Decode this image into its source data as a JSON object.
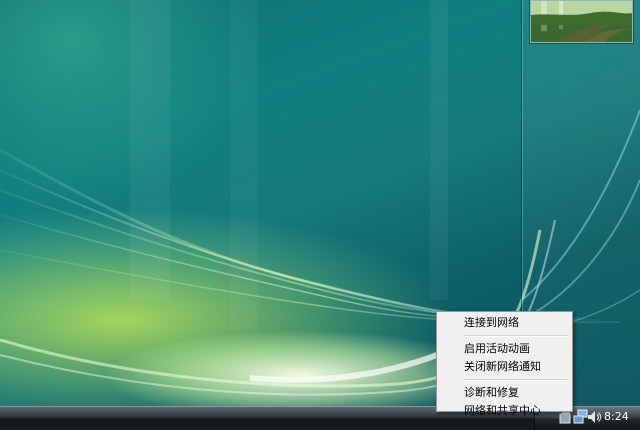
{
  "context_menu": {
    "items": [
      {
        "label": "连接到网络"
      },
      {
        "label": "启用活动动画"
      },
      {
        "label": "关闭新网络通知"
      },
      {
        "label": "诊断和修复"
      },
      {
        "label": "网络和共享中心"
      }
    ]
  },
  "taskbar": {
    "clock": "8:24",
    "tray_icons": [
      "tray-icon",
      "network-icon",
      "volume-icon"
    ]
  },
  "sidebar": {
    "gadget": "slideshow-gadget"
  },
  "colors": {
    "menu_bg": "#f0f0f0",
    "menu_border": "#979797",
    "taskbar_dark": "#121518",
    "wallpaper_teal": "#0f7f80"
  }
}
